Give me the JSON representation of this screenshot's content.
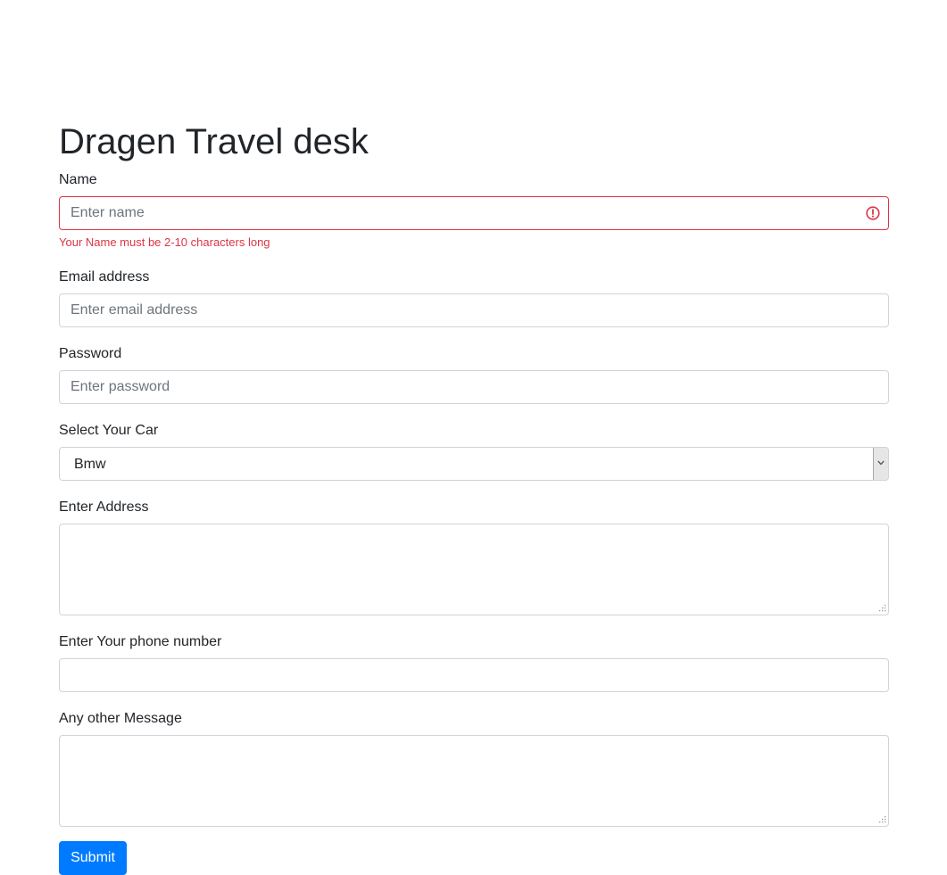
{
  "form": {
    "title": "Dragen Travel desk",
    "name": {
      "label": "Name",
      "placeholder": "Enter name",
      "value": "",
      "error": "Your Name must be 2-10 characters long"
    },
    "email": {
      "label": "Email address",
      "placeholder": "Enter email address",
      "value": ""
    },
    "password": {
      "label": "Password",
      "placeholder": "Enter password",
      "value": ""
    },
    "car": {
      "label": "Select Your Car",
      "selected": "Bmw"
    },
    "address": {
      "label": "Enter Address",
      "value": ""
    },
    "phone": {
      "label": "Enter Your phone number",
      "value": ""
    },
    "message": {
      "label": "Any other Message",
      "value": ""
    },
    "submit_label": "Submit"
  },
  "colors": {
    "primary": "#007bff",
    "danger": "#dc3545",
    "border": "#ced4da",
    "text": "#212529"
  },
  "icons": {
    "invalid": "exclamation-circle-icon",
    "select": "chevron-down-icon",
    "resize": "resize-grip-icon"
  }
}
